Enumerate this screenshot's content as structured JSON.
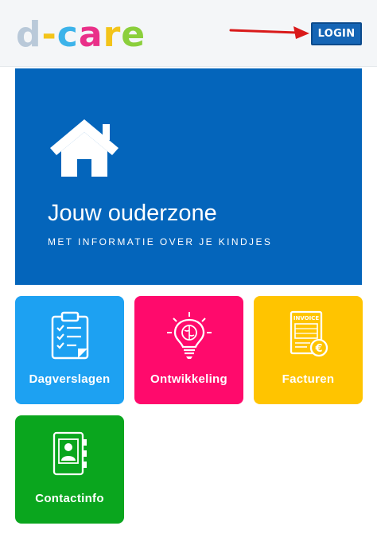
{
  "header": {
    "logo": {
      "letters": [
        "d",
        "-",
        "c",
        "a",
        "r",
        "e"
      ],
      "colors": [
        "#b9c9d9",
        "#f3c41a",
        "#3cb3ea",
        "#e93089",
        "#f3c41a",
        "#8bcf3c"
      ]
    },
    "login_label": "LOGIN"
  },
  "hero": {
    "title": "Jouw ouderzone",
    "subtitle": "MET INFORMATIE OVER JE KINDJES",
    "icon": "home-icon"
  },
  "tiles": [
    {
      "label": "Dagverslagen",
      "icon": "clipboard-checklist-icon",
      "color": "#1da1f2"
    },
    {
      "label": "Ontwikkeling",
      "icon": "lightbulb-brain-icon",
      "color": "#ff0a6c"
    },
    {
      "label": "Facturen",
      "icon": "invoice-euro-icon",
      "color": "#ffc400",
      "icon_text": "INVOICE"
    },
    {
      "label": "Contactinfo",
      "icon": "address-book-icon",
      "color": "#0aa61e"
    }
  ]
}
